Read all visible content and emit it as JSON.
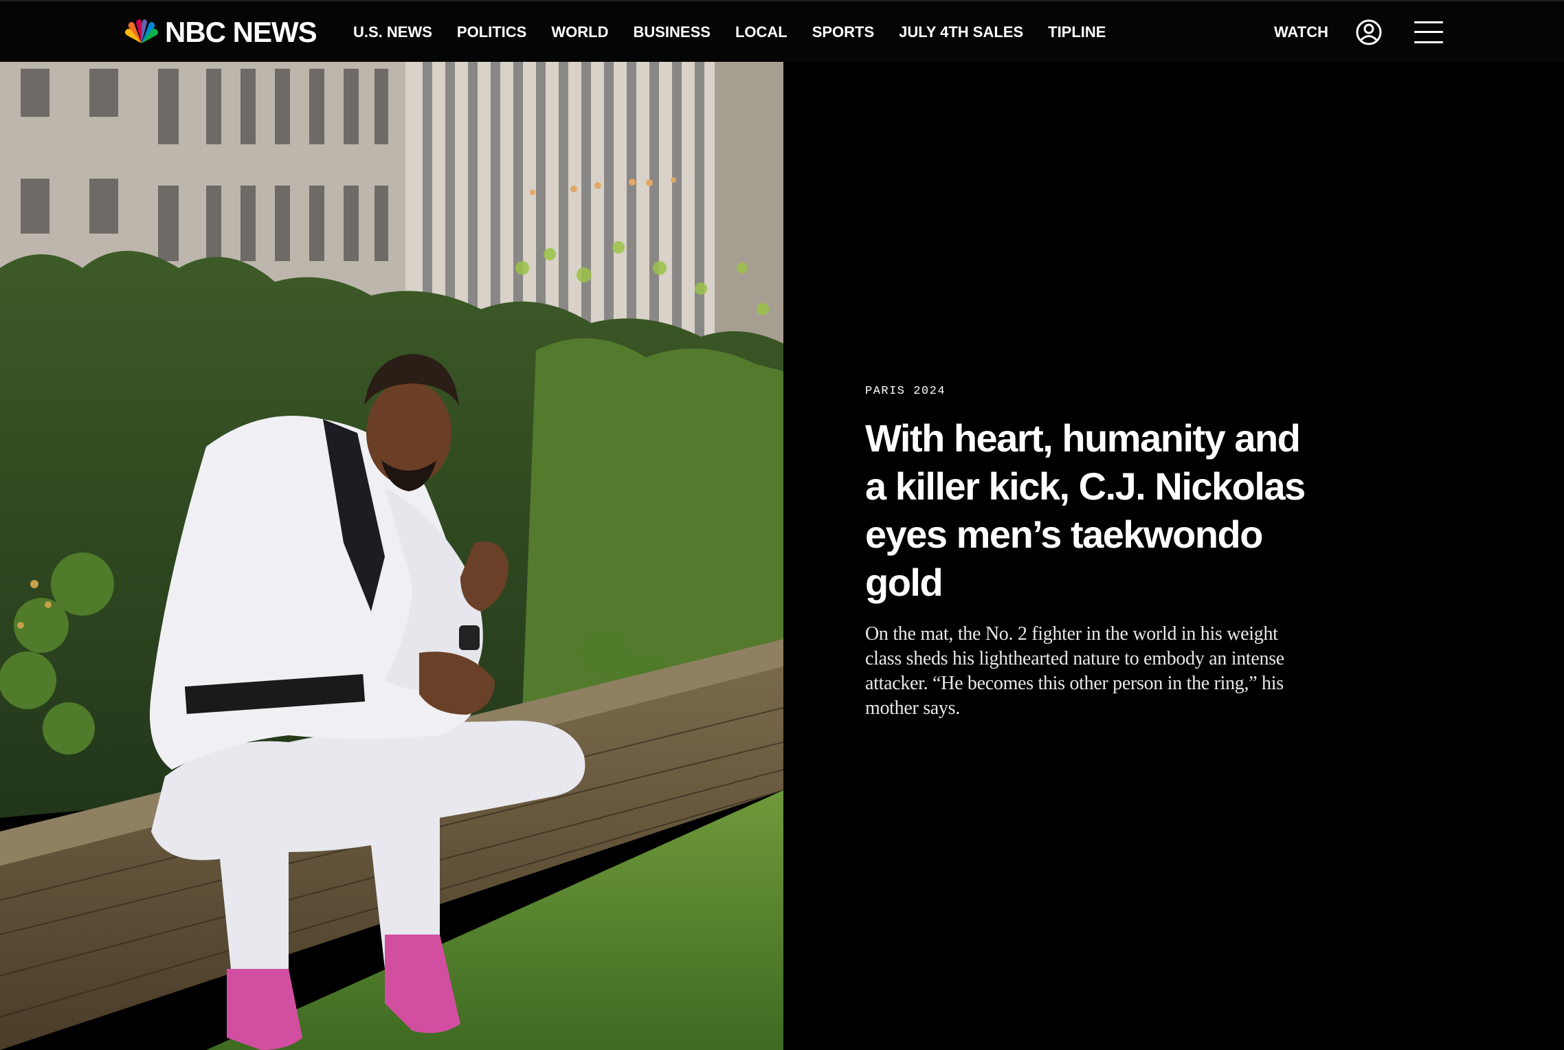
{
  "header": {
    "logo_text": "NBC NEWS",
    "nav": [
      "U.S. NEWS",
      "POLITICS",
      "WORLD",
      "BUSINESS",
      "LOCAL",
      "SPORTS",
      "JULY 4TH SALES",
      "TIPLINE"
    ],
    "watch_label": "WATCH",
    "icons": {
      "account": "user-account-icon",
      "menu": "hamburger-menu-icon"
    }
  },
  "article": {
    "eyebrow": "PARIS 2024",
    "headline": "With heart, humanity and a killer kick, C.J. Nickolas eyes men’s taekwondo gold",
    "dek": "On the mat, the No. 2 fighter in the world in his weight class sheds his lighthearted nature to embody an intense attacker. “He becomes this other person in the ring,” his mother says."
  },
  "colors": {
    "background": "#000000",
    "text": "#ffffff",
    "peacock": [
      "#fcb711",
      "#f37021",
      "#cc004c",
      "#6460aa",
      "#0089d0",
      "#0db14b"
    ]
  }
}
